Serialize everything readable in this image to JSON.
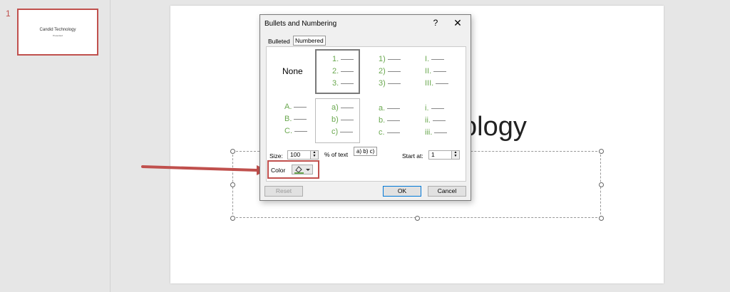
{
  "thumbnail": {
    "slide_number": "1",
    "title": "Candid Technology",
    "subtitle": "Presented"
  },
  "slide": {
    "title_visible": "ology"
  },
  "dialog": {
    "title": "Bullets and Numbering",
    "help": "?",
    "close": "✕",
    "tabs": [
      {
        "label": "Bulleted",
        "mnemonic": "B"
      },
      {
        "label": "Numbered",
        "mnemonic": "N"
      }
    ],
    "none_label": "None",
    "styles": [
      [
        "1.",
        "2.",
        "3."
      ],
      [
        "1)",
        "2)",
        "3)"
      ],
      [
        "I.",
        "II.",
        "III."
      ],
      [
        "A.",
        "B.",
        "C."
      ],
      [
        "a)",
        "b)",
        "c)"
      ],
      [
        "a.",
        "b.",
        "c."
      ],
      [
        "i.",
        "ii.",
        "iii."
      ]
    ],
    "size_label": "Size:",
    "size_value": "100",
    "percent_label": "% of text",
    "tooltip": "a) b) c)",
    "start_label": "Start at:",
    "start_value": "1",
    "color_label": "Color",
    "reset": "Reset",
    "ok": "OK",
    "cancel": "Cancel"
  },
  "colors": {
    "number_color": "#6aa84f",
    "highlight": "#c0504d",
    "arrow": "#c0504d"
  }
}
